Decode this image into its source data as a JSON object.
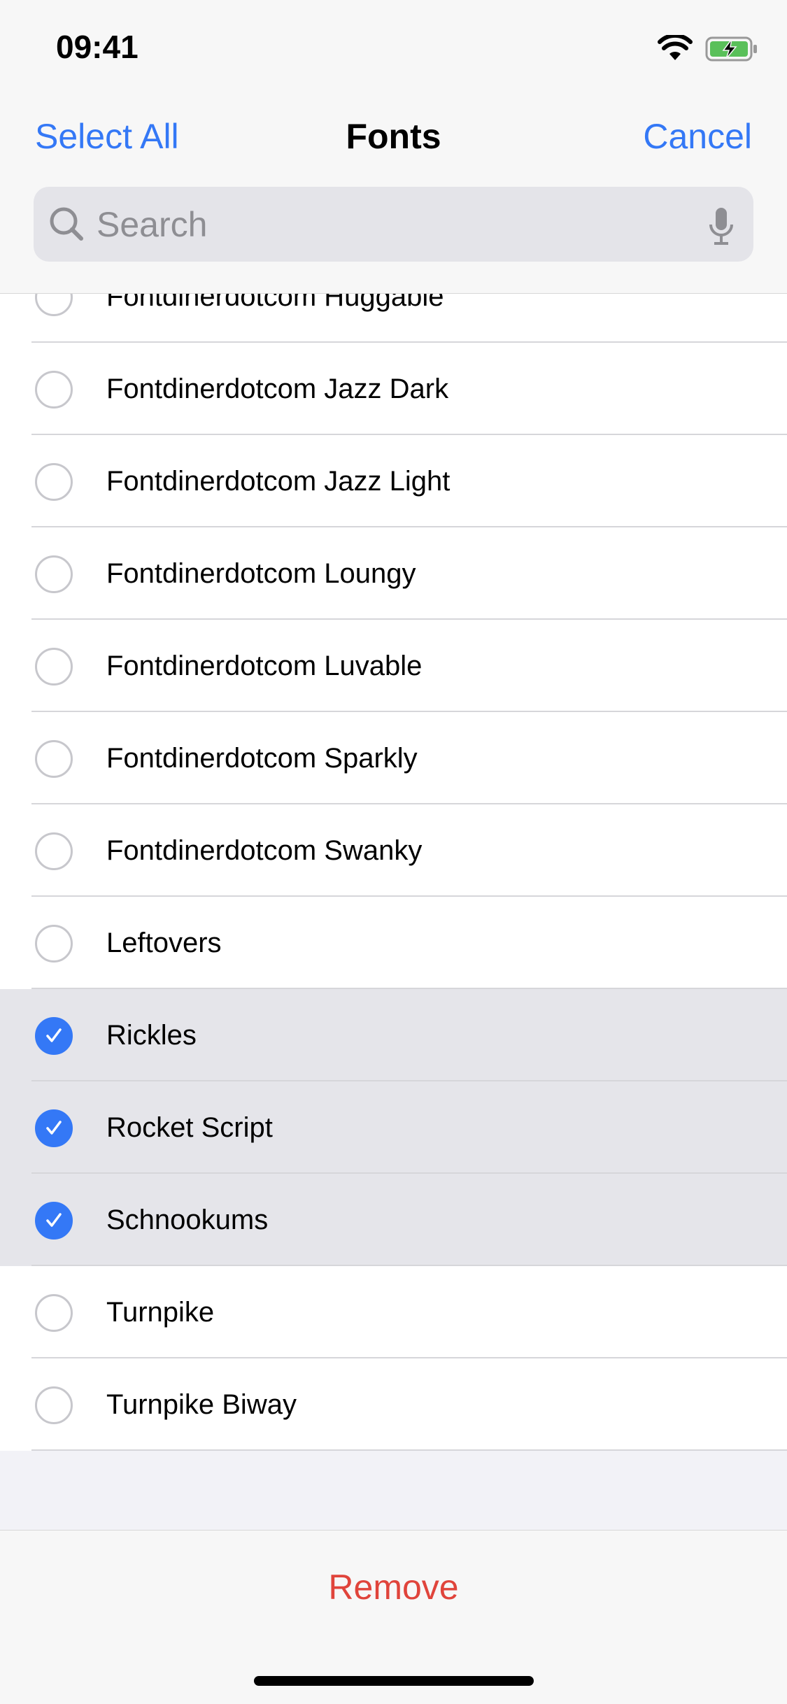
{
  "status_bar": {
    "time": "09:41",
    "icons": [
      "wifi-icon",
      "battery-charging-icon"
    ]
  },
  "nav": {
    "left": "Select All",
    "title": "Fonts",
    "right": "Cancel"
  },
  "search": {
    "placeholder": "Search",
    "value": ""
  },
  "colors": {
    "accent": "#3478f6",
    "destructive": "#e0443b",
    "selected_row": "#e5e5ea"
  },
  "fonts": [
    {
      "name": "Fontdinerdotcom Huggable",
      "selected": false
    },
    {
      "name": "Fontdinerdotcom Jazz Dark",
      "selected": false
    },
    {
      "name": "Fontdinerdotcom Jazz Light",
      "selected": false
    },
    {
      "name": "Fontdinerdotcom Loungy",
      "selected": false
    },
    {
      "name": "Fontdinerdotcom Luvable",
      "selected": false
    },
    {
      "name": "Fontdinerdotcom Sparkly",
      "selected": false
    },
    {
      "name": "Fontdinerdotcom Swanky",
      "selected": false
    },
    {
      "name": "Leftovers",
      "selected": false
    },
    {
      "name": "Rickles",
      "selected": true
    },
    {
      "name": "Rocket Script",
      "selected": true
    },
    {
      "name": "Schnookums",
      "selected": true
    },
    {
      "name": "Turnpike",
      "selected": false
    },
    {
      "name": "Turnpike Biway",
      "selected": false
    }
  ],
  "toolbar": {
    "remove": "Remove"
  }
}
